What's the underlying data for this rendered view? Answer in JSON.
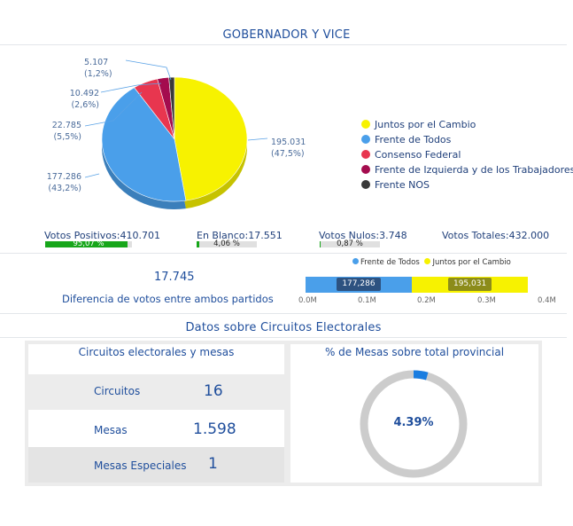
{
  "header": {
    "title": "GOBERNADOR Y VICE"
  },
  "pie": {
    "slices": [
      {
        "name": "Juntos por el Cambio",
        "votes": "195.031",
        "pct": "(47,5%)",
        "value": 195031,
        "color": "#f7f200"
      },
      {
        "name": "Frente de Todos",
        "votes": "177.286",
        "pct": "(43,2%)",
        "value": 177286,
        "color": "#4a9fea"
      },
      {
        "name": "Consenso Federal",
        "votes": "22.785",
        "pct": "(5,5%)",
        "value": 22785,
        "color": "#e8364f"
      },
      {
        "name": "Frente de Izquierda y de los Trabajadores",
        "votes": "10.492",
        "pct": "(2,6%)",
        "value": 10492,
        "color": "#a40c4e"
      },
      {
        "name": "Frente NOS",
        "votes": "5.107",
        "pct": "(1,2%)",
        "value": 5107,
        "color": "#3a3a3a"
      }
    ]
  },
  "stats": {
    "positivos": {
      "label": "Votos Positivos:",
      "value": "410.701",
      "bar_pct": "95,07 %",
      "fraction": 0.9507,
      "color": "#17a61a"
    },
    "blanco": {
      "label": "En Blanco:",
      "value": "17.551",
      "bar_pct": "4,06 %",
      "fraction": 0.0406,
      "color": "#17a61a"
    },
    "nulos": {
      "label": "Votos Nulos:",
      "value": "3.748",
      "bar_pct": "0,87 %",
      "fraction": 0.0087,
      "color": "#17a61a"
    },
    "totales": {
      "label": "Votos Totales:",
      "value": "432.000"
    }
  },
  "difference": {
    "value": "17.745",
    "label": "Diferencia de votos entre ambos partidos"
  },
  "stacked": {
    "legend": [
      {
        "name": "Frente de Todos",
        "color": "#4a9fea"
      },
      {
        "name": "Juntos por el Cambio",
        "color": "#f7f200"
      }
    ],
    "segments": [
      {
        "name": "Frente de Todos",
        "value": 177286,
        "label": "177,286",
        "color": "#4a9fea",
        "label_bg": "#2d5280"
      },
      {
        "name": "Juntos por el Cambio",
        "value": 195031,
        "label": "195,031",
        "color": "#f7f200",
        "label_bg": "#8c8c1a"
      }
    ],
    "axis_max": 400000,
    "ticks": [
      "0.0M",
      "0.1M",
      "0.2M",
      "0.3M",
      "0.4M"
    ]
  },
  "circuits_section": {
    "title": "Datos sobre Circuitos Electorales"
  },
  "table": {
    "title": "Circuitos electorales y mesas",
    "rows": [
      {
        "label": "Circuitos",
        "value": "16"
      },
      {
        "label": "Mesas",
        "value": "1.598"
      },
      {
        "label": "Mesas Especiales",
        "value": "1"
      }
    ]
  },
  "donut": {
    "title": "% de Mesas sobre total provincial",
    "value": "4.39%",
    "fraction": 0.0439,
    "color": "#1a7de0",
    "track": "#cccccc"
  }
}
